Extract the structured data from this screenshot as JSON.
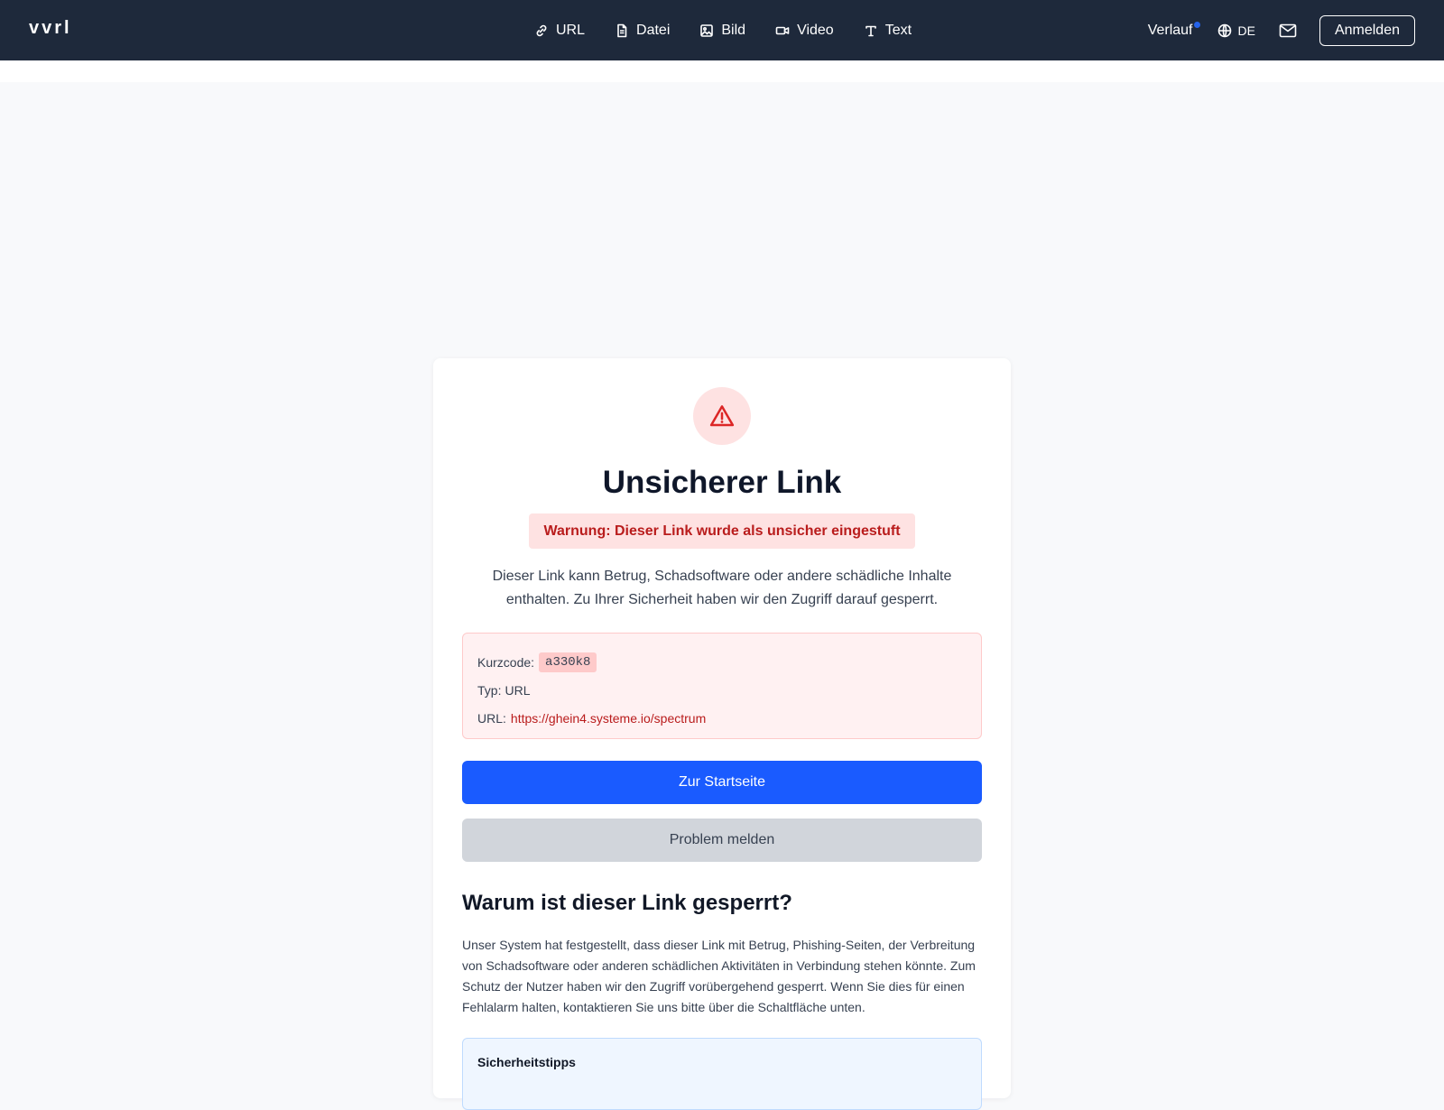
{
  "header": {
    "logo": "vvrl",
    "nav": [
      {
        "label": "URL",
        "icon": "link-icon"
      },
      {
        "label": "Datei",
        "icon": "file-icon"
      },
      {
        "label": "Bild",
        "icon": "image-icon"
      },
      {
        "label": "Video",
        "icon": "video-icon"
      },
      {
        "label": "Text",
        "icon": "text-icon"
      }
    ],
    "history_label": "Verlauf",
    "language": "DE",
    "login_label": "Anmelden"
  },
  "card": {
    "title": "Unsicherer Link",
    "warning_badge": "Warnung: Dieser Link wurde als unsicher eingestuft",
    "description": "Dieser Link kann Betrug, Schadsoftware oder andere schädliche Inhalte enthalten. Zu Ihrer Sicherheit haben wir den Zugriff darauf gesperrt.",
    "info": {
      "shortcode_label": "Kurzcode:",
      "shortcode_value": "a330k8",
      "type_label": "Typ:",
      "type_value": "URL",
      "url_label": "URL:",
      "url_value": "https://ghein4.systeme.io/spectrum"
    },
    "primary_button": "Zur Startseite",
    "secondary_button": "Problem melden",
    "why_heading": "Warum ist dieser Link gesperrt?",
    "why_text": "Unser System hat festgestellt, dass dieser Link mit Betrug, Phishing-Seiten, der Verbreitung von Schadsoftware oder anderen schädlichen Aktivitäten in Verbindung stehen könnte. Zum Schutz der Nutzer haben wir den Zugriff vorübergehend gesperrt. Wenn Sie dies für einen Fehlalarm halten, kontaktieren Sie uns bitte über die Schaltfläche unten.",
    "tips_heading": "Sicherheitstipps"
  },
  "colors": {
    "topbar": "#1e293b",
    "primary": "#1a5bff",
    "danger": "#b91c1c",
    "danger_bg": "#fee2e2",
    "notification_dot": "#2563eb"
  }
}
